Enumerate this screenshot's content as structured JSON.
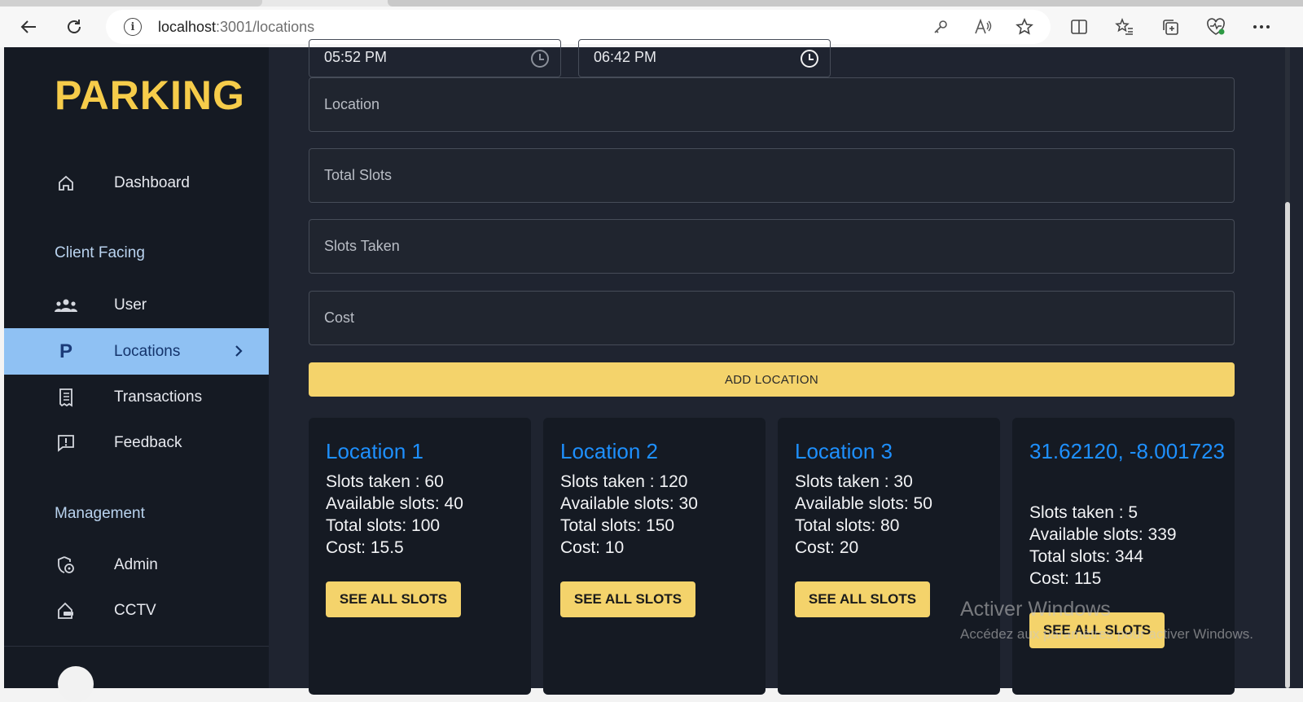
{
  "browser": {
    "url_host": "localhost",
    "url_path": ":3001/locations"
  },
  "sidebar": {
    "brand": "PARKING",
    "items": [
      {
        "label": "Dashboard",
        "icon": "home-icon"
      },
      {
        "label": "User",
        "icon": "users-icon"
      },
      {
        "label": "Locations",
        "icon": "parking-p-icon",
        "active": true
      },
      {
        "label": "Transactions",
        "icon": "receipt-icon"
      },
      {
        "label": "Feedback",
        "icon": "feedback-icon"
      },
      {
        "label": "Admin",
        "icon": "admin-shield-icon"
      },
      {
        "label": "CCTV",
        "icon": "cctv-home-icon"
      }
    ],
    "sections": {
      "client_facing": "Client Facing",
      "management": "Management"
    }
  },
  "form": {
    "start_time": "05:52 PM",
    "end_time": "06:42 PM",
    "location_placeholder": "Location",
    "total_slots_placeholder": "Total Slots",
    "slots_taken_placeholder": "Slots Taken",
    "cost_placeholder": "Cost",
    "submit_label": "ADD LOCATION"
  },
  "locations": [
    {
      "title": "Location 1",
      "slots_taken": "Slots taken : 60",
      "available": "Available slots: 40",
      "total": "Total slots: 100",
      "cost": "Cost: 15.5",
      "button": "SEE ALL SLOTS"
    },
    {
      "title": "Location 2",
      "slots_taken": "Slots taken : 120",
      "available": "Available slots: 30",
      "total": "Total slots: 150",
      "cost": "Cost: 10",
      "button": "SEE ALL SLOTS"
    },
    {
      "title": "Location 3",
      "slots_taken": "Slots taken : 30",
      "available": "Available slots: 50",
      "total": "Total slots: 80",
      "cost": "Cost: 20",
      "button": "SEE ALL SLOTS"
    },
    {
      "title": "31.62120, -8.001723",
      "slots_taken": "Slots taken : 5",
      "available": "Available slots: 339",
      "total": "Total slots: 344",
      "cost": "Cost: 115",
      "button": "SEE ALL SLOTS"
    }
  ],
  "watermark": {
    "line1": "Activer Windows",
    "line2": "Accédez aux paramètres pour activer Windows."
  },
  "colors": {
    "accent_yellow": "#f4d36b",
    "brand_yellow": "#f6cc4a",
    "link_blue": "#1e90ff",
    "active_nav": "#8fc1f3",
    "sidebar_bg": "#151a23",
    "main_bg": "#1f2430"
  }
}
